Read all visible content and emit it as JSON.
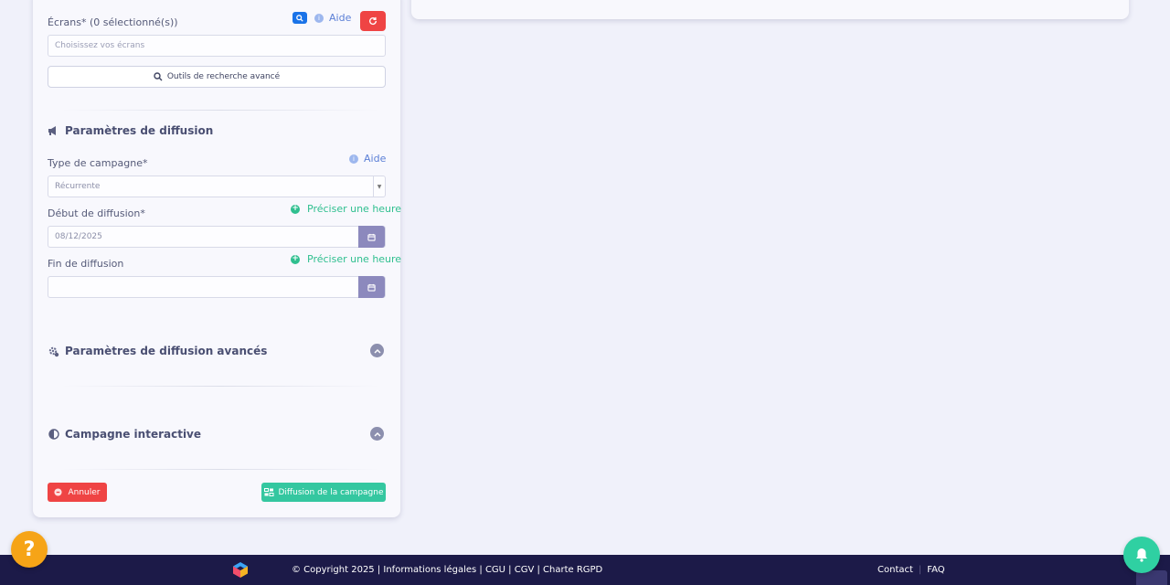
{
  "screens": {
    "label": "Écrans* (0 sélectionné(s))",
    "help_label": "Aide",
    "placeholder": "Choisissez vos écrans",
    "advanced_search_label": "Outils de recherche avancé"
  },
  "broadcast": {
    "title": "Paramètres de diffusion",
    "help_label": "Aide",
    "campaign_type_label": "Type de campagne*",
    "campaign_type_value": "Récurrente",
    "start_label": "Début de diffusion*",
    "start_value": "08/12/2025",
    "end_label": "Fin de diffusion",
    "end_value": "",
    "precise_hour_label": "Préciser une heure"
  },
  "advanced": {
    "title": "Paramètres de diffusion avancés"
  },
  "interactive": {
    "title": "Campagne interactive"
  },
  "actions": {
    "cancel_label": "Annuler",
    "submit_label": "Diffusion de la campagne"
  },
  "footer": {
    "copyright": "© Copyright 2025 | Informations légales | CGU | CGV | Charte RGPD",
    "contact_label": "Contact",
    "faq_label": "FAQ"
  },
  "colors": {
    "accent_red": "#ef4444",
    "accent_green": "#34c7a0",
    "footer_bg": "#1c1a48",
    "help_orange": "#f6a417"
  },
  "icons": [
    "search-icon",
    "info-icon",
    "refresh-icon",
    "megaphone-icon",
    "calendar-icon",
    "plus-circle-icon",
    "settings-icon",
    "chevron-up-icon",
    "interactive-icon",
    "cancel-icon",
    "broadcast-icon",
    "question-icon",
    "bell-icon",
    "logo-icon"
  ]
}
